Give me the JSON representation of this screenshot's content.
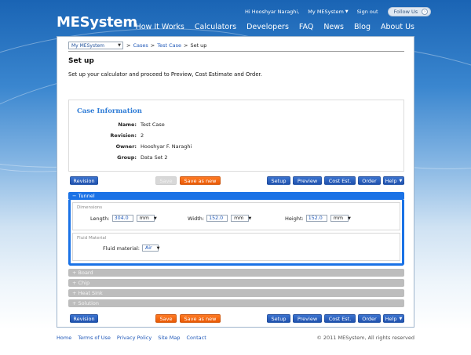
{
  "header": {
    "logo": "MESystem",
    "greeting": "Hi Hooshyar Naraghi,",
    "my_mesystem": "My MESystem",
    "sign_out": "Sign out",
    "follow_us": "Follow Us",
    "nav": [
      "How It Works",
      "Calculators",
      "Developers",
      "FAQ",
      "News",
      "Blog",
      "About Us"
    ]
  },
  "breadcrumb": {
    "select_value": "My MESystem",
    "sep1": ">",
    "cases": "Cases",
    "sep2": ">",
    "test_case": "Test Case",
    "sep3": ">",
    "current": "Set up"
  },
  "page": {
    "title": "Set up",
    "intro": "Set up your calculator and proceed to Preview, Cost Estimate and Order."
  },
  "case_info": {
    "title": "Case Information",
    "rows": [
      {
        "label": "Name:",
        "value": "Test Case"
      },
      {
        "label": "Revision:",
        "value": "2"
      },
      {
        "label": "Owner:",
        "value": "Hooshyar F. Naraghi"
      },
      {
        "label": "Group:",
        "value": "Data Set 2"
      }
    ]
  },
  "toolbar_top": {
    "revision": "Revision",
    "save": "Save",
    "save_as_new": "Save as new",
    "setup": "Setup",
    "preview": "Preview",
    "cost_est": "Cost Est.",
    "order": "Order",
    "help": "Help"
  },
  "toolbar_bottom": {
    "revision": "Revision",
    "save": "Save",
    "save_as_new": "Save as new",
    "setup": "Setup",
    "preview": "Preview",
    "cost_est": "Cost Est.",
    "order": "Order",
    "help": "Help"
  },
  "tunnel": {
    "header": "−  Tunnel",
    "dimensions": {
      "legend": "Dimensions",
      "length_label": "Length:",
      "length_value": "304.0",
      "length_unit": "mm",
      "width_label": "Width:",
      "width_value": "152.0",
      "width_unit": "mm",
      "height_label": "Height:",
      "height_value": "152.0",
      "height_unit": "mm"
    },
    "fluid": {
      "legend": "Fluid Material",
      "label": "Fluid material:",
      "value": "Air"
    }
  },
  "sections": [
    "+  Board",
    "+  Chip",
    "+  Heat Sink",
    "+  Solution"
  ],
  "footer": {
    "links": [
      "Home",
      "Terms of Use",
      "Privacy Policy",
      "Site Map",
      "Contact"
    ],
    "copyright": "© 2011 MESystem, All rights reserved"
  },
  "colors": {
    "primary_blue": "#2152ae",
    "active_accordion": "#1a72e6",
    "orange": "#e95a07",
    "link": "#1e57b8"
  }
}
